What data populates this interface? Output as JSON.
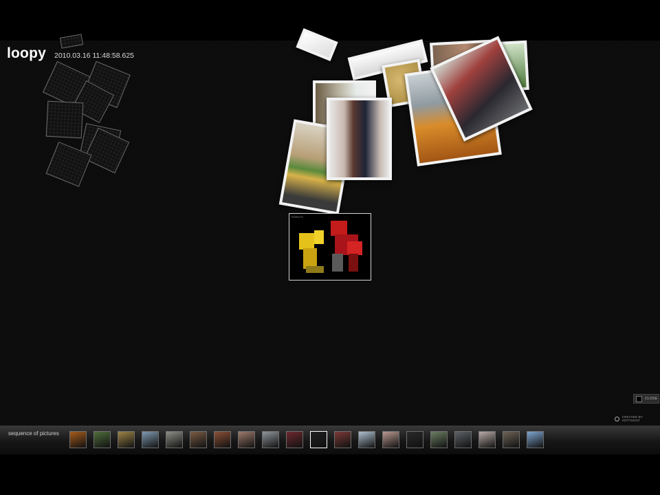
{
  "app": {
    "name": "loopy",
    "timestamp": "2010.03.16  11:48:58.625"
  },
  "controls": {
    "close_label": "CLOSE",
    "credit": "CREATED BY HOTTSHOT"
  },
  "filmstrip": {
    "label": "sequence of pictures",
    "thumbnails": [
      {
        "name": "sunset-orange",
        "color": "#a55c1c"
      },
      {
        "name": "green-trees",
        "color": "#4f6e3c"
      },
      {
        "name": "cup-drink",
        "color": "#9c8447"
      },
      {
        "name": "city-sky",
        "color": "#7f98b0"
      },
      {
        "name": "building-crowd",
        "color": "#8e8e86"
      },
      {
        "name": "woman-kitchen",
        "color": "#7a5c44"
      },
      {
        "name": "colorful-crowd",
        "color": "#8a5037"
      },
      {
        "name": "portrait-woman",
        "color": "#9c7a6c"
      },
      {
        "name": "cloudy-sky",
        "color": "#8f959a"
      },
      {
        "name": "red-trees",
        "color": "#6e2a30"
      },
      {
        "name": "robots-toy",
        "color": "#1f1f1f"
      },
      {
        "name": "red-bus",
        "color": "#7a3a38"
      },
      {
        "name": "tower-sky",
        "color": "#aebfd0"
      },
      {
        "name": "hand-portrait",
        "color": "#b99990"
      },
      {
        "name": "sunglasses-man",
        "color": "#2a2a2a"
      },
      {
        "name": "park-people",
        "color": "#6c7f62"
      },
      {
        "name": "grey-horizon",
        "color": "#5d6266"
      },
      {
        "name": "white-hair-portrait",
        "color": "#b8aaa6"
      },
      {
        "name": "room-interior",
        "color": "#6d6355"
      },
      {
        "name": "blue-sky",
        "color": "#7ea4cf"
      }
    ],
    "active_index": 10
  },
  "featured": {
    "caption": "ROBOTS"
  }
}
